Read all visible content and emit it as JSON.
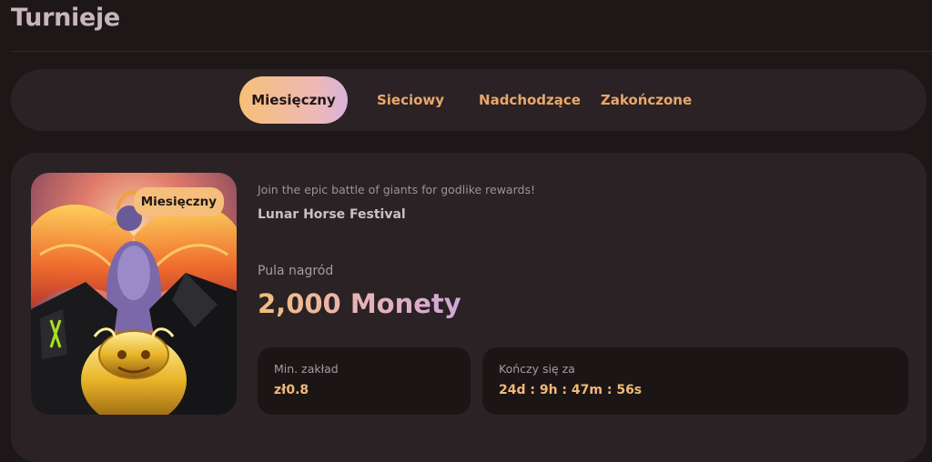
{
  "page": {
    "title": "Turnieje"
  },
  "tabs": [
    {
      "label": "Miesięczny",
      "active": true
    },
    {
      "label": "Sieciowy",
      "active": false
    },
    {
      "label": "Nadchodzące",
      "active": false
    },
    {
      "label": "Zakończone",
      "active": false
    }
  ],
  "tournament": {
    "badge": "Miesięczny",
    "tagline": "Join the epic battle of giants for godlike rewards!",
    "name": "Lunar Horse Festival",
    "prize_pool_label": "Pula nagród",
    "prize_pool_value": "2,000 Monety",
    "min_bet_label": "Min. zakład",
    "min_bet_value": "zł0.8",
    "ends_in_label": "Kończy się za",
    "ends_in_value": "24d : 9h : 47m : 56s"
  },
  "colors": {
    "background": "#1d1718",
    "panel": "#2a2224",
    "accent": "#f0b978",
    "tab_text": "#e9a86a"
  },
  "icons": {
    "hero_image": "phoenix-and-golden-lion-artwork"
  }
}
